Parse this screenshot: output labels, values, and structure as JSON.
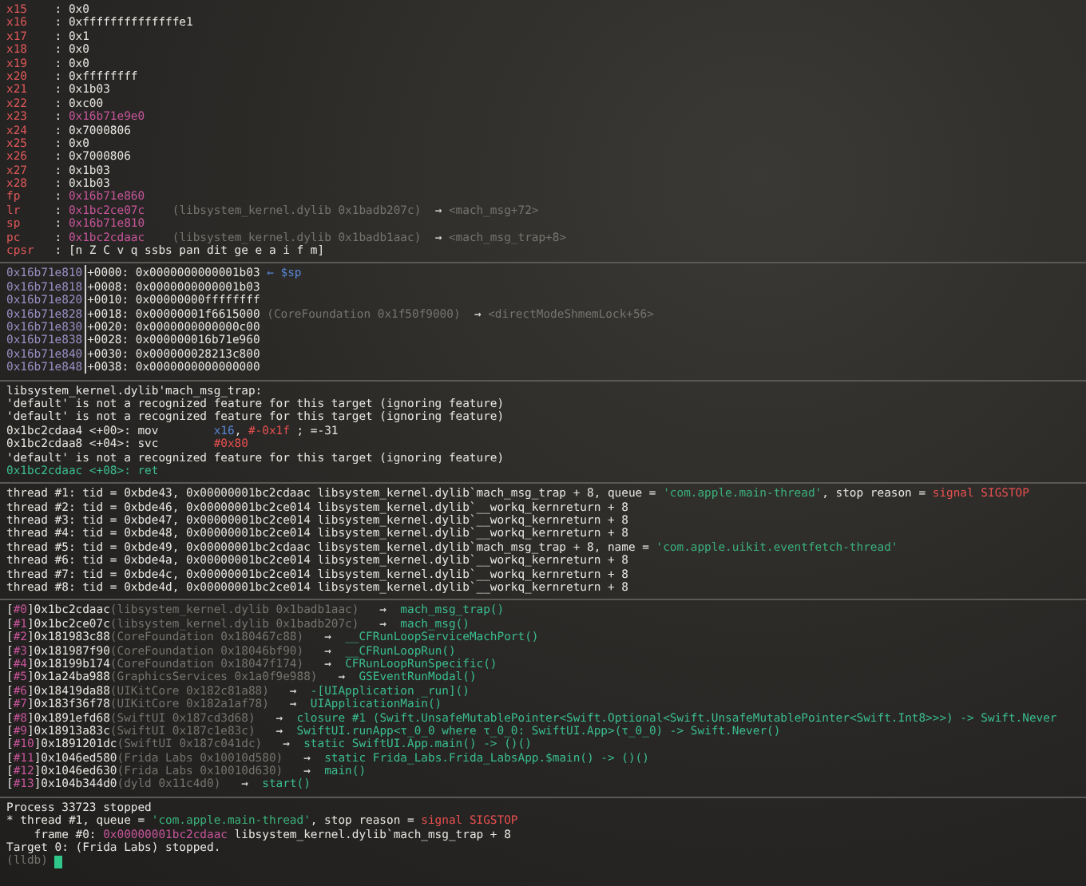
{
  "sections": [
    {
      "lines": [
        {
          "segments": [
            {
              "kind": "reg",
              "text": "x15"
            },
            {
              "kind": "plain",
              "text": "    : 0x0"
            }
          ]
        },
        {
          "segments": [
            {
              "kind": "reg",
              "text": "x16"
            },
            {
              "kind": "plain",
              "text": "    : 0xffffffffffffffe1"
            }
          ]
        },
        {
          "segments": [
            {
              "kind": "reg",
              "text": "x17"
            },
            {
              "kind": "plain",
              "text": "    : 0x1"
            }
          ]
        },
        {
          "segments": [
            {
              "kind": "reg",
              "text": "x18"
            },
            {
              "kind": "plain",
              "text": "    : 0x0"
            }
          ]
        },
        {
          "segments": [
            {
              "kind": "reg",
              "text": "x19"
            },
            {
              "kind": "plain",
              "text": "    : 0x0"
            }
          ]
        },
        {
          "segments": [
            {
              "kind": "reg",
              "text": "x20"
            },
            {
              "kind": "plain",
              "text": "    : 0xffffffff"
            }
          ]
        },
        {
          "segments": [
            {
              "kind": "reg",
              "text": "x21"
            },
            {
              "kind": "plain",
              "text": "    : 0x1b03"
            }
          ]
        },
        {
          "segments": [
            {
              "kind": "reg",
              "text": "x22"
            },
            {
              "kind": "plain",
              "text": "    : 0xc00"
            }
          ]
        },
        {
          "segments": [
            {
              "kind": "reg",
              "text": "x23"
            },
            {
              "kind": "plain",
              "text": "    : "
            },
            {
              "kind": "addr",
              "text": "0x16b71e9e0"
            }
          ]
        },
        {
          "segments": [
            {
              "kind": "reg",
              "text": "x24"
            },
            {
              "kind": "plain",
              "text": "    : 0x7000806"
            }
          ]
        },
        {
          "segments": [
            {
              "kind": "reg",
              "text": "x25"
            },
            {
              "kind": "plain",
              "text": "    : 0x0"
            }
          ]
        },
        {
          "segments": [
            {
              "kind": "reg",
              "text": "x26"
            },
            {
              "kind": "plain",
              "text": "    : 0x7000806"
            }
          ]
        },
        {
          "segments": [
            {
              "kind": "reg",
              "text": "x27"
            },
            {
              "kind": "plain",
              "text": "    : 0x1b03"
            }
          ]
        },
        {
          "segments": [
            {
              "kind": "reg",
              "text": "x28"
            },
            {
              "kind": "plain",
              "text": "    : 0x1b03"
            }
          ]
        },
        {
          "segments": [
            {
              "kind": "reg",
              "text": "fp"
            },
            {
              "kind": "plain",
              "text": "     : "
            },
            {
              "kind": "addr",
              "text": "0x16b71e860"
            }
          ]
        },
        {
          "segments": [
            {
              "kind": "reg",
              "text": "lr"
            },
            {
              "kind": "plain",
              "text": "     : "
            },
            {
              "kind": "addr",
              "text": "0x1bc2ce07c"
            },
            {
              "kind": "dim",
              "text": "    (libsystem_kernel.dylib 0x1badb207c)  "
            },
            {
              "kind": "plain",
              "text": "→ "
            },
            {
              "kind": "dim",
              "text": "<mach_msg+72>"
            }
          ]
        },
        {
          "segments": [
            {
              "kind": "reg",
              "text": "sp"
            },
            {
              "kind": "plain",
              "text": "     : "
            },
            {
              "kind": "addr",
              "text": "0x16b71e810"
            }
          ]
        },
        {
          "segments": [
            {
              "kind": "reg",
              "text": "pc"
            },
            {
              "kind": "plain",
              "text": "     : "
            },
            {
              "kind": "addr",
              "text": "0x1bc2cdaac"
            },
            {
              "kind": "dim",
              "text": "    (libsystem_kernel.dylib 0x1badb1aac)  "
            },
            {
              "kind": "plain",
              "text": "→ "
            },
            {
              "kind": "dim",
              "text": "<mach_msg_trap+8>"
            }
          ]
        },
        {
          "segments": [
            {
              "kind": "reg",
              "text": "cpsr"
            },
            {
              "kind": "plain",
              "text": "   : [n Z C v q ssbs pan dit ge e a i f m]"
            }
          ]
        }
      ]
    },
    {
      "lines": [
        {
          "segments": [
            {
              "kind": "gutter",
              "text": "0x16b71e810"
            },
            {
              "kind": "plain",
              "text": "+0000: 0x0000000000001b03 "
            },
            {
              "kind": "hint",
              "text": "← $sp"
            }
          ]
        },
        {
          "segments": [
            {
              "kind": "gutter",
              "text": "0x16b71e818"
            },
            {
              "kind": "plain",
              "text": "+0008: 0x0000000000001b03"
            }
          ]
        },
        {
          "segments": [
            {
              "kind": "gutter",
              "text": "0x16b71e820"
            },
            {
              "kind": "plain",
              "text": "+0010: 0x00000000ffffffff"
            }
          ]
        },
        {
          "segments": [
            {
              "kind": "gutter",
              "text": "0x16b71e828"
            },
            {
              "kind": "plain",
              "text": "+0018: 0x00000001f6615000 "
            },
            {
              "kind": "dim",
              "text": "(CoreFoundation 0x1f50f9000)  "
            },
            {
              "kind": "plain",
              "text": "→ "
            },
            {
              "kind": "dim",
              "text": "<directModeShmemLock+56>"
            }
          ]
        },
        {
          "segments": [
            {
              "kind": "gutter",
              "text": "0x16b71e830"
            },
            {
              "kind": "plain",
              "text": "+0020: 0x0000000000000c00"
            }
          ]
        },
        {
          "segments": [
            {
              "kind": "gutter",
              "text": "0x16b71e838"
            },
            {
              "kind": "plain",
              "text": "+0028: 0x000000016b71e960"
            }
          ]
        },
        {
          "segments": [
            {
              "kind": "gutter",
              "text": "0x16b71e840"
            },
            {
              "kind": "plain",
              "text": "+0030: 0x000000028213c800"
            }
          ]
        },
        {
          "segments": [
            {
              "kind": "gutter",
              "text": "0x16b71e848"
            },
            {
              "kind": "plain",
              "text": "+0038: 0x0000000000000000"
            }
          ]
        }
      ]
    },
    {
      "lines": [
        {
          "segments": [
            {
              "kind": "plain",
              "text": "libsystem_kernel.dylib'mach_msg_trap:"
            }
          ]
        },
        {
          "segments": [
            {
              "kind": "plain",
              "text": "'default' is not a recognized feature for this target (ignoring feature)"
            }
          ]
        },
        {
          "segments": [
            {
              "kind": "plain",
              "text": "'default' is not a recognized feature for this target (ignoring feature)"
            }
          ]
        },
        {
          "segments": [
            {
              "kind": "plain",
              "text": "0x1bc2cdaa4 <+00>: mov        "
            },
            {
              "kind": "hint",
              "text": "x16"
            },
            {
              "kind": "plain",
              "text": ", "
            },
            {
              "kind": "num",
              "text": "#-0x1f"
            },
            {
              "kind": "plain",
              "text": " ; =-31"
            }
          ]
        },
        {
          "segments": [
            {
              "kind": "plain",
              "text": "0x1bc2cdaa8 <+04>: svc        "
            },
            {
              "kind": "num",
              "text": "#0x80"
            }
          ]
        },
        {
          "segments": [
            {
              "kind": "plain",
              "text": "'default' is not a recognized feature for this target (ignoring feature)"
            }
          ]
        },
        {
          "segments": [
            {
              "kind": "func",
              "text": "0x1bc2cdaac <+08>: ret"
            }
          ]
        }
      ]
    },
    {
      "lines": [
        {
          "segments": [
            {
              "kind": "plain",
              "text": "thread #1: tid = 0xbde43, 0x00000001bc2cdaac libsystem_kernel.dylib`mach_msg_trap + 8, queue = "
            },
            {
              "kind": "str",
              "text": "'com.apple.main-thread'"
            },
            {
              "kind": "plain",
              "text": ", stop reason = "
            },
            {
              "kind": "num",
              "text": "signal SIGSTOP"
            }
          ]
        },
        {
          "segments": [
            {
              "kind": "plain",
              "text": "thread #2: tid = 0xbde46, 0x00000001bc2ce014 libsystem_kernel.dylib`__workq_kernreturn + 8"
            }
          ]
        },
        {
          "segments": [
            {
              "kind": "plain",
              "text": "thread #3: tid = 0xbde47, 0x00000001bc2ce014 libsystem_kernel.dylib`__workq_kernreturn + 8"
            }
          ]
        },
        {
          "segments": [
            {
              "kind": "plain",
              "text": "thread #4: tid = 0xbde48, 0x00000001bc2ce014 libsystem_kernel.dylib`__workq_kernreturn + 8"
            }
          ]
        },
        {
          "segments": [
            {
              "kind": "plain",
              "text": "thread #5: tid = 0xbde49, 0x00000001bc2cdaac libsystem_kernel.dylib`mach_msg_trap + 8, name = "
            },
            {
              "kind": "str",
              "text": "'com.apple.uikit.eventfetch-thread'"
            }
          ]
        },
        {
          "segments": [
            {
              "kind": "plain",
              "text": "thread #6: tid = 0xbde4a, 0x00000001bc2ce014 libsystem_kernel.dylib`__workq_kernreturn + 8"
            }
          ]
        },
        {
          "segments": [
            {
              "kind": "plain",
              "text": "thread #7: tid = 0xbde4c, 0x00000001bc2ce014 libsystem_kernel.dylib`__workq_kernreturn + 8"
            }
          ]
        },
        {
          "segments": [
            {
              "kind": "plain",
              "text": "thread #8: tid = 0xbde4d, 0x00000001bc2ce014 libsystem_kernel.dylib`__workq_kernreturn + 8"
            }
          ]
        }
      ]
    },
    {
      "lines": [
        {
          "segments": [
            {
              "kind": "plain",
              "text": "["
            },
            {
              "kind": "addr",
              "text": "#0"
            },
            {
              "kind": "plain",
              "text": "]0x1bc2cdaac"
            },
            {
              "kind": "dim",
              "text": "(libsystem_kernel.dylib 0x1badb1aac)"
            },
            {
              "kind": "plain",
              "text": "   →  "
            },
            {
              "kind": "func",
              "text": "mach_msg_trap()"
            }
          ]
        },
        {
          "segments": [
            {
              "kind": "plain",
              "text": "["
            },
            {
              "kind": "addr",
              "text": "#1"
            },
            {
              "kind": "plain",
              "text": "]0x1bc2ce07c"
            },
            {
              "kind": "dim",
              "text": "(libsystem_kernel.dylib 0x1badb207c)"
            },
            {
              "kind": "plain",
              "text": "   →  "
            },
            {
              "kind": "func",
              "text": "mach_msg()"
            }
          ]
        },
        {
          "segments": [
            {
              "kind": "plain",
              "text": "["
            },
            {
              "kind": "addr",
              "text": "#2"
            },
            {
              "kind": "plain",
              "text": "]0x181983c88"
            },
            {
              "kind": "dim",
              "text": "(CoreFoundation 0x180467c88)"
            },
            {
              "kind": "plain",
              "text": "   →  "
            },
            {
              "kind": "func",
              "text": "__CFRunLoopServiceMachPort()"
            }
          ]
        },
        {
          "segments": [
            {
              "kind": "plain",
              "text": "["
            },
            {
              "kind": "addr",
              "text": "#3"
            },
            {
              "kind": "plain",
              "text": "]0x181987f90"
            },
            {
              "kind": "dim",
              "text": "(CoreFoundation 0x18046bf90)"
            },
            {
              "kind": "plain",
              "text": "   →  "
            },
            {
              "kind": "func",
              "text": "__CFRunLoopRun()"
            }
          ]
        },
        {
          "segments": [
            {
              "kind": "plain",
              "text": "["
            },
            {
              "kind": "addr",
              "text": "#4"
            },
            {
              "kind": "plain",
              "text": "]0x18199b174"
            },
            {
              "kind": "dim",
              "text": "(CoreFoundation 0x18047f174)"
            },
            {
              "kind": "plain",
              "text": "   →  "
            },
            {
              "kind": "func",
              "text": "CFRunLoopRunSpecific()"
            }
          ]
        },
        {
          "segments": [
            {
              "kind": "plain",
              "text": "["
            },
            {
              "kind": "addr",
              "text": "#5"
            },
            {
              "kind": "plain",
              "text": "]0x1a24ba988"
            },
            {
              "kind": "dim",
              "text": "(GraphicsServices 0x1a0f9e988)"
            },
            {
              "kind": "plain",
              "text": "   →  "
            },
            {
              "kind": "func",
              "text": "GSEventRunModal()"
            }
          ]
        },
        {
          "segments": [
            {
              "kind": "plain",
              "text": "["
            },
            {
              "kind": "addr",
              "text": "#6"
            },
            {
              "kind": "plain",
              "text": "]0x18419da88"
            },
            {
              "kind": "dim",
              "text": "(UIKitCore 0x182c81a88)"
            },
            {
              "kind": "plain",
              "text": "   →  "
            },
            {
              "kind": "func",
              "text": "-[UIApplication _run]()"
            }
          ]
        },
        {
          "segments": [
            {
              "kind": "plain",
              "text": "["
            },
            {
              "kind": "addr",
              "text": "#7"
            },
            {
              "kind": "plain",
              "text": "]0x183f36f78"
            },
            {
              "kind": "dim",
              "text": "(UIKitCore 0x182a1af78)"
            },
            {
              "kind": "plain",
              "text": "   →  "
            },
            {
              "kind": "func",
              "text": "UIApplicationMain()"
            }
          ]
        },
        {
          "segments": [
            {
              "kind": "plain",
              "text": "["
            },
            {
              "kind": "addr",
              "text": "#8"
            },
            {
              "kind": "plain",
              "text": "]0x1891efd68"
            },
            {
              "kind": "dim",
              "text": "(SwiftUI 0x187cd3d68)"
            },
            {
              "kind": "plain",
              "text": "   →  "
            },
            {
              "kind": "func",
              "text": "closure #1 (Swift.UnsafeMutablePointer<Swift.Optional<Swift.UnsafeMutablePointer<Swift.Int8>>>) -> Swift.Never"
            }
          ]
        },
        {
          "segments": [
            {
              "kind": "plain",
              "text": "["
            },
            {
              "kind": "addr",
              "text": "#9"
            },
            {
              "kind": "plain",
              "text": "]0x18913a83c"
            },
            {
              "kind": "dim",
              "text": "(SwiftUI 0x187c1e83c)"
            },
            {
              "kind": "plain",
              "text": "   →  "
            },
            {
              "kind": "func",
              "text": "SwiftUI.runApp<τ_0_0 where τ_0_0: SwiftUI.App>(τ_0_0) -> Swift.Never()"
            }
          ]
        },
        {
          "segments": [
            {
              "kind": "plain",
              "text": "["
            },
            {
              "kind": "addr",
              "text": "#10"
            },
            {
              "kind": "plain",
              "text": "]0x1891201dc"
            },
            {
              "kind": "dim",
              "text": "(SwiftUI 0x187c041dc)"
            },
            {
              "kind": "plain",
              "text": "   →  "
            },
            {
              "kind": "func",
              "text": "static SwiftUI.App.main() -> ()()"
            }
          ]
        },
        {
          "segments": [
            {
              "kind": "plain",
              "text": "["
            },
            {
              "kind": "addr",
              "text": "#11"
            },
            {
              "kind": "plain",
              "text": "]0x1046ed580"
            },
            {
              "kind": "dim",
              "text": "(Frida Labs 0x10010d580)"
            },
            {
              "kind": "plain",
              "text": "   →  "
            },
            {
              "kind": "func",
              "text": "static Frida_Labs.Frida_LabsApp.$main() -> ()()"
            }
          ]
        },
        {
          "segments": [
            {
              "kind": "plain",
              "text": "["
            },
            {
              "kind": "addr",
              "text": "#12"
            },
            {
              "kind": "plain",
              "text": "]0x1046ed630"
            },
            {
              "kind": "dim",
              "text": "(Frida Labs 0x10010d630)"
            },
            {
              "kind": "plain",
              "text": "   →  "
            },
            {
              "kind": "func",
              "text": "main()"
            }
          ]
        },
        {
          "segments": [
            {
              "kind": "plain",
              "text": "["
            },
            {
              "kind": "addr",
              "text": "#13"
            },
            {
              "kind": "plain",
              "text": "]0x104b344d0"
            },
            {
              "kind": "dim",
              "text": "(dyld 0x11c4d0)"
            },
            {
              "kind": "plain",
              "text": "   →  "
            },
            {
              "kind": "func",
              "text": "start()"
            }
          ]
        }
      ]
    },
    {
      "lines": [
        {
          "segments": [
            {
              "kind": "plain",
              "text": "Process 33723 stopped"
            }
          ]
        },
        {
          "segments": [
            {
              "kind": "plain",
              "text": "* thread #1, queue = "
            },
            {
              "kind": "str",
              "text": "'com.apple.main-thread'"
            },
            {
              "kind": "plain",
              "text": ", stop reason = "
            },
            {
              "kind": "num",
              "text": "signal SIGSTOP"
            }
          ]
        },
        {
          "segments": [
            {
              "kind": "plain",
              "text": "    frame #0: "
            },
            {
              "kind": "addr",
              "text": "0x00000001bc2cdaac"
            },
            {
              "kind": "plain",
              "text": " libsystem_kernel.dylib`mach_msg_trap + 8"
            }
          ]
        },
        {
          "segments": [
            {
              "kind": "plain",
              "text": "Target 0: (Frida Labs) stopped."
            }
          ]
        },
        {
          "segments": [
            {
              "kind": "dim",
              "text": "(lldb) "
            }
          ],
          "cursor": true
        }
      ]
    }
  ]
}
